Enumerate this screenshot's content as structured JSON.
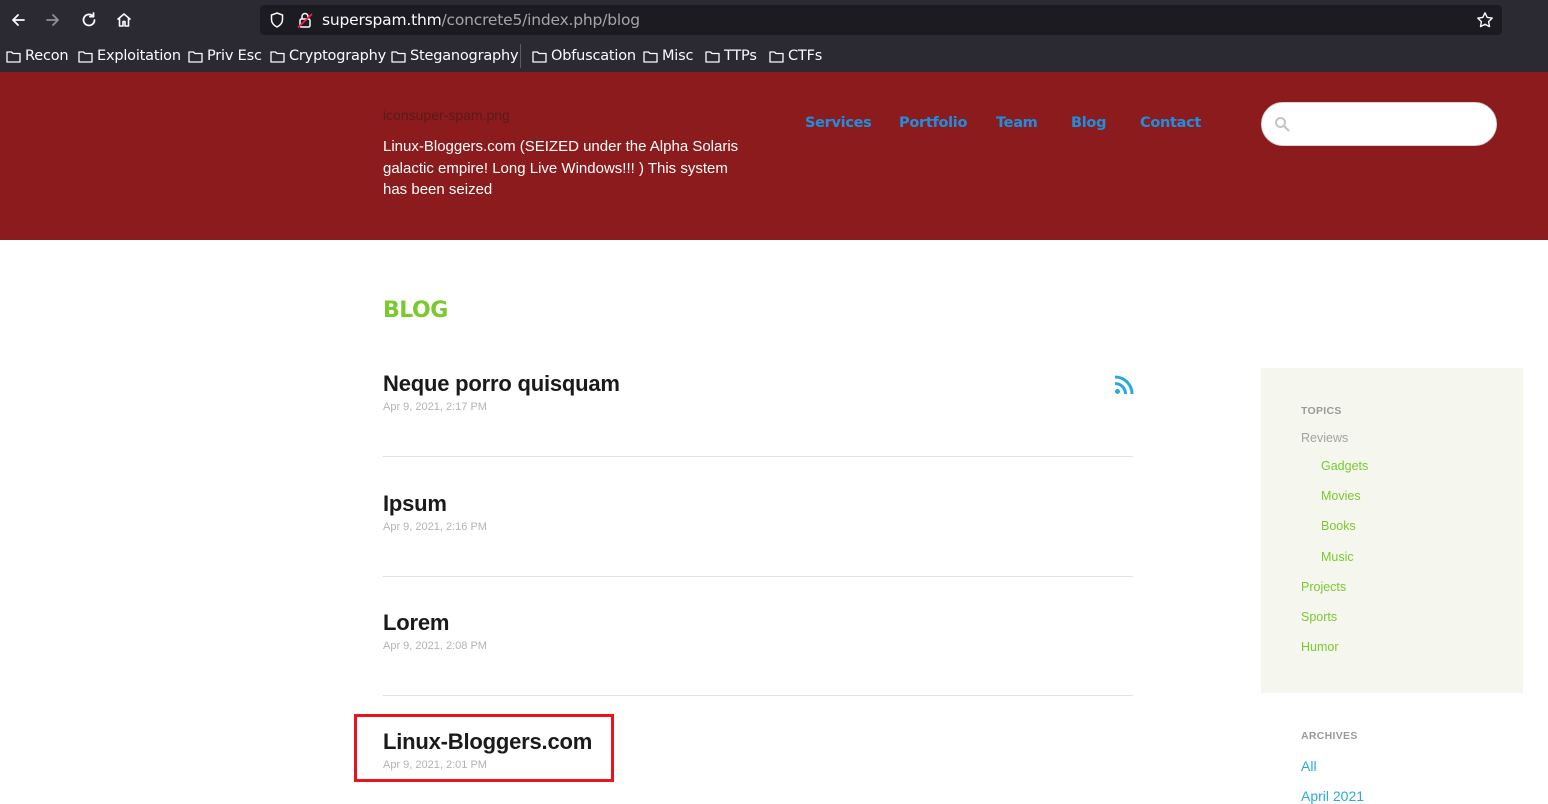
{
  "browser": {
    "url_host": "superspam.thm",
    "url_path": "/concrete5/index.php/blog",
    "bookmarks": [
      "Recon",
      "Exploitation",
      "Priv Esc",
      "Cryptography",
      "Steganography",
      "Obfuscation",
      "Misc",
      "TTPs",
      "CTFs"
    ],
    "icons": [
      "back-icon",
      "forward-icon",
      "reload-icon",
      "home-icon",
      "shield-icon",
      "lock-icon",
      "bookmark-star-icon",
      "folder-icon"
    ]
  },
  "site": {
    "logo_alt": "iconsuper-spam.png",
    "description": "Linux-Bloggers.com (SEIZED under the Alpha Solaris galactic empire! Long Live Windows!!! ) This system has been seized",
    "nav": [
      "Services",
      "Portfolio",
      "Team",
      "Blog",
      "Contact"
    ],
    "search_placeholder": ""
  },
  "main": {
    "heading": "BLOG",
    "posts": [
      {
        "title": "Neque porro quisquam",
        "date": "Apr 9, 2021, 2:17 PM"
      },
      {
        "title": "Ipsum",
        "date": "Apr 9, 2021, 2:16 PM"
      },
      {
        "title": "Lorem",
        "date": "Apr 9, 2021, 2:08 PM"
      },
      {
        "title": "Linux-Bloggers.com",
        "date": "Apr 9, 2021, 2:01 PM"
      }
    ]
  },
  "sidebar": {
    "topics_heading": "TOPICS",
    "topics": [
      {
        "label": "Reviews"
      },
      {
        "label": "Gadgets"
      },
      {
        "label": "Movies"
      },
      {
        "label": "Books"
      },
      {
        "label": "Music"
      },
      {
        "label": "Projects"
      },
      {
        "label": "Sports"
      },
      {
        "label": "Humor"
      }
    ],
    "archives_heading": "ARCHIVES",
    "archives": [
      "All",
      "April 2021"
    ]
  },
  "colors": {
    "header_bg": "#8b1b1c",
    "nav_link": "#1e8fe0",
    "heading_green": "#7ac930",
    "highlight_red": "#e8141b",
    "sidebar_bg": "#f5f6ee",
    "archive_link": "#2aa8e0"
  }
}
